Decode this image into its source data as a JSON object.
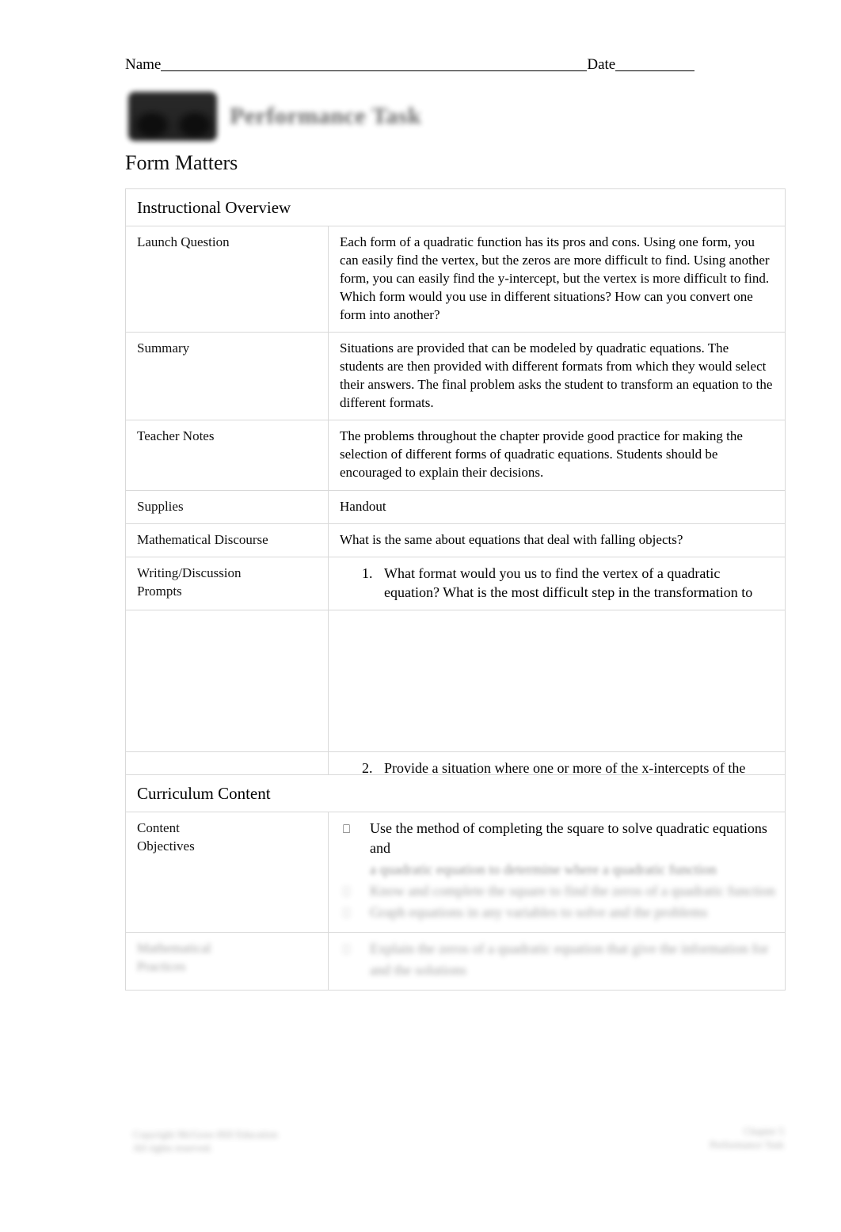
{
  "header": {
    "name_label": "Name",
    "date_label": "Date",
    "banner_title": "Performance Task",
    "logo_name": "publisher-logo"
  },
  "document": {
    "title": "Form Matters"
  },
  "instructional_overview": {
    "section_title": "Instructional Overview",
    "rows": [
      {
        "label": "Launch Question",
        "body": "Each form of a quadratic function has its pros and cons. Using one form, you can easily find the vertex, but the zeros are more difficult to find. Using another form, you can easily find the y-intercept, but the vertex is more difficult to find. Which form would you use in different situations? How can you convert one form into another?"
      },
      {
        "label": "Summary",
        "body": "Situations are provided that can be modeled by quadratic equations. The students are then provided with different formats from which they would select their answers. The final problem asks the student to transform an equation to the different formats."
      },
      {
        "label": "Teacher Notes",
        "body": "The problems throughout the chapter provide good practice for making the selection of different forms of quadratic equations. Students should be encouraged to explain their decisions."
      },
      {
        "label": "Supplies",
        "body": "Handout"
      },
      {
        "label": "Mathematical Discourse",
        "body": "What is the same about equations that deal with falling objects?"
      }
    ],
    "prompts": {
      "label_line1": "Writing/Discussion",
      "label_line2": "Prompts",
      "items": [
        "What format would you us to find the vertex of a quadratic equation? What is the most difficult step in the transformation to",
        "Provide a situation where one or more of the x-intercepts of the graph of a quadratic equation would be a solution to the equation."
      ]
    }
  },
  "curriculum_content": {
    "section_title": "Curriculum Content",
    "objectives": {
      "label_line1": "Content",
      "label_line2": "Objectives",
      "bullet_glyph": "⎕",
      "items": [
        "Use the method of completing the square to solve quadratic equations and",
        "a quadratic equation to determine where a quadratic function",
        "Know and complete the square to find the zeros of a quadratic function",
        "Graph equations in any variables to solve and the problems",
        "Explain the zeros of a quadratic equation that give the information for and the solutions"
      ]
    },
    "practices": {
      "label_line1": "Mathematical",
      "label_line2": "Practices",
      "items": [
        "Explain the zeros of a quadratic equation that give the information for",
        "and the solutions"
      ]
    }
  },
  "footer": {
    "left_line1": "Copyright McGraw-Hill Education",
    "left_line2": "All rights reserved.",
    "right_line1": "Chapter 5",
    "right_line2": "Performance Task"
  }
}
